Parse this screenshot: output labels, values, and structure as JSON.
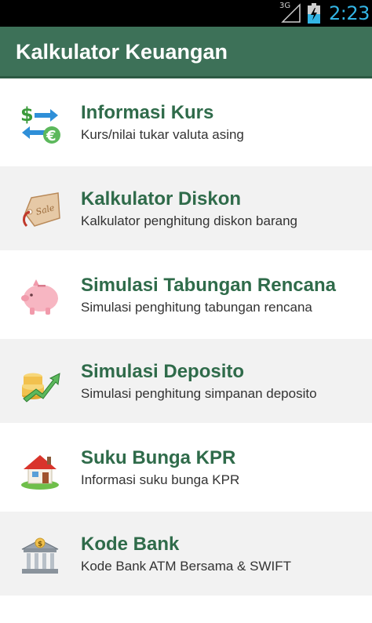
{
  "status_bar": {
    "network": "3G",
    "clock": "2:23"
  },
  "app_bar": {
    "title": "Kalkulator Keuangan"
  },
  "menu": {
    "items": [
      {
        "icon": "currency-exchange-icon",
        "title": "Informasi Kurs",
        "subtitle": "Kurs/nilai tukar valuta asing"
      },
      {
        "icon": "sale-tag-icon",
        "title": "Kalkulator Diskon",
        "subtitle": "Kalkulator penghitung diskon barang"
      },
      {
        "icon": "piggy-bank-icon",
        "title": "Simulasi Tabungan Rencana",
        "subtitle": "Simulasi penghitung tabungan rencana"
      },
      {
        "icon": "coins-growth-icon",
        "title": "Simulasi Deposito",
        "subtitle": "Simulasi penghitung simpanan deposito"
      },
      {
        "icon": "house-icon",
        "title": "Suku Bunga KPR",
        "subtitle": "Informasi suku bunga KPR"
      },
      {
        "icon": "bank-building-icon",
        "title": "Kode Bank",
        "subtitle": "Kode Bank ATM Bersama & SWIFT"
      }
    ]
  },
  "colors": {
    "app_bar": "#3d7158",
    "title_text": "#2f6b4a",
    "status_accent": "#33b5e5"
  }
}
